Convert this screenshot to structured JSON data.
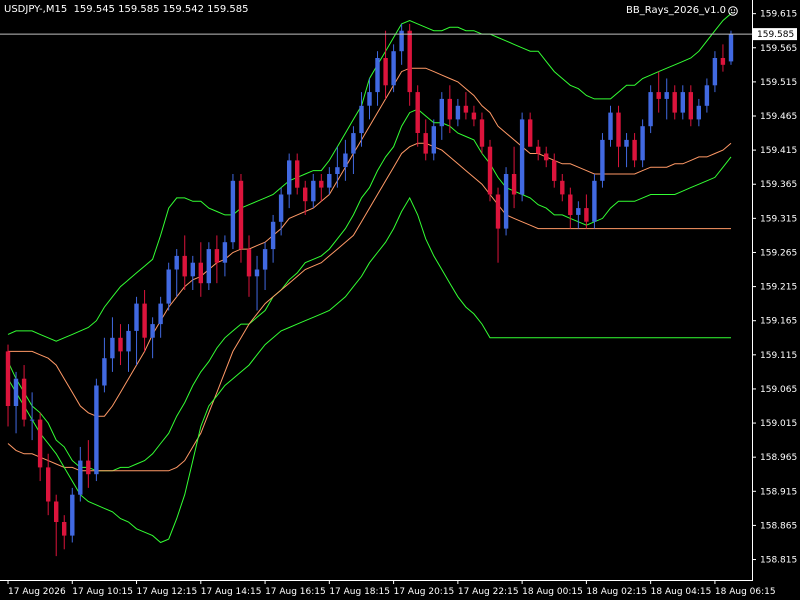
{
  "window": {
    "symbol": "USDJPY-,M15",
    "ohlc": "159.545 159.585 159.542 159.585",
    "indicator_name": "BB_Rays_2026_v1.0",
    "indicator_icon": "smiley-icon"
  },
  "colors": {
    "background": "#000000",
    "axis": "#ffffff",
    "bull_candle": "#4169e1",
    "bear_candle": "#dc143c",
    "outer_band": "#33ff33",
    "inner_band": "#ff9966",
    "price_line": "#c0c0c0"
  },
  "chart_data": {
    "type": "candlestick",
    "title": "",
    "xlabel": "",
    "ylabel": "",
    "ylim": [
      158.785,
      159.635
    ],
    "y_ticks": [
      "159.615",
      "159.565",
      "159.515",
      "159.465",
      "159.415",
      "159.365",
      "159.315",
      "159.265",
      "159.215",
      "159.165",
      "159.115",
      "159.065",
      "159.015",
      "158.965",
      "158.915",
      "158.865",
      "158.815"
    ],
    "x_ticks": [
      "17 Aug 2026",
      "17 Aug 10:15",
      "17 Aug 12:15",
      "17 Aug 14:15",
      "17 Aug 16:15",
      "17 Aug 18:15",
      "17 Aug 20:15",
      "17 Aug 22:15",
      "18 Aug 00:15",
      "18 Aug 02:15",
      "18 Aug 04:15",
      "18 Aug 06:15"
    ],
    "x_tick_bars": [
      0,
      8,
      16,
      24,
      32,
      40,
      48,
      56,
      64,
      72,
      80,
      88
    ],
    "current_price": "159.585",
    "candles": [
      [
        159.12,
        159.13,
        159.01,
        159.04
      ],
      [
        159.04,
        159.09,
        159.0,
        159.08
      ],
      [
        159.08,
        159.1,
        159.01,
        159.02
      ],
      [
        159.02,
        159.06,
        158.99,
        159.02
      ],
      [
        159.02,
        159.03,
        158.93,
        158.95
      ],
      [
        158.95,
        158.97,
        158.88,
        158.9
      ],
      [
        158.9,
        158.91,
        158.82,
        158.87
      ],
      [
        158.87,
        158.88,
        158.83,
        158.85
      ],
      [
        158.85,
        158.92,
        158.84,
        158.91
      ],
      [
        158.91,
        158.98,
        158.9,
        158.96
      ],
      [
        158.96,
        158.99,
        158.92,
        158.94
      ],
      [
        158.94,
        159.08,
        158.93,
        159.07
      ],
      [
        159.07,
        159.14,
        159.06,
        159.11
      ],
      [
        159.11,
        159.17,
        159.09,
        159.14
      ],
      [
        159.14,
        159.16,
        159.1,
        159.12
      ],
      [
        159.12,
        159.16,
        159.09,
        159.15
      ],
      [
        159.15,
        159.2,
        159.1,
        159.19
      ],
      [
        159.19,
        159.21,
        159.12,
        159.14
      ],
      [
        159.14,
        159.17,
        159.11,
        159.16
      ],
      [
        159.16,
        159.2,
        159.14,
        159.19
      ],
      [
        159.19,
        159.25,
        159.18,
        159.24
      ],
      [
        159.24,
        159.27,
        159.2,
        159.26
      ],
      [
        159.26,
        159.29,
        159.21,
        159.23
      ],
      [
        159.23,
        159.26,
        159.21,
        159.25
      ],
      [
        159.25,
        159.28,
        159.2,
        159.22
      ],
      [
        159.22,
        159.28,
        159.21,
        159.27
      ],
      [
        159.27,
        159.29,
        159.22,
        159.25
      ],
      [
        159.25,
        159.29,
        159.23,
        159.28
      ],
      [
        159.28,
        159.38,
        159.27,
        159.37
      ],
      [
        159.37,
        159.38,
        159.25,
        159.27
      ],
      [
        159.27,
        159.29,
        159.2,
        159.23
      ],
      [
        159.23,
        159.26,
        159.18,
        159.24
      ],
      [
        159.24,
        159.28,
        159.21,
        159.27
      ],
      [
        159.27,
        159.32,
        159.25,
        159.31
      ],
      [
        159.31,
        159.36,
        159.29,
        159.35
      ],
      [
        159.35,
        159.41,
        159.33,
        159.4
      ],
      [
        159.4,
        159.41,
        159.35,
        159.36
      ],
      [
        159.36,
        159.37,
        159.32,
        159.34
      ],
      [
        159.34,
        159.38,
        159.33,
        159.37
      ],
      [
        159.37,
        159.38,
        159.34,
        159.36
      ],
      [
        159.36,
        159.39,
        159.35,
        159.38
      ],
      [
        159.38,
        159.42,
        159.36,
        159.39
      ],
      [
        159.39,
        159.43,
        159.37,
        159.41
      ],
      [
        159.41,
        159.45,
        159.38,
        159.44
      ],
      [
        159.44,
        159.5,
        159.42,
        159.48
      ],
      [
        159.48,
        159.52,
        159.46,
        159.5
      ],
      [
        159.5,
        159.56,
        159.48,
        159.55
      ],
      [
        159.55,
        159.59,
        159.49,
        159.51
      ],
      [
        159.51,
        159.57,
        159.5,
        159.56
      ],
      [
        159.56,
        159.6,
        159.54,
        159.59
      ],
      [
        159.59,
        159.6,
        159.48,
        159.5
      ],
      [
        159.5,
        159.51,
        159.42,
        159.44
      ],
      [
        159.44,
        159.46,
        159.4,
        159.41
      ],
      [
        159.41,
        159.46,
        159.4,
        159.45
      ],
      [
        159.45,
        159.5,
        159.43,
        159.49
      ],
      [
        159.49,
        159.51,
        159.44,
        159.46
      ],
      [
        159.46,
        159.49,
        159.45,
        159.48
      ],
      [
        159.48,
        159.5,
        159.46,
        159.47
      ],
      [
        159.47,
        159.48,
        159.45,
        159.46
      ],
      [
        159.46,
        159.47,
        159.41,
        159.42
      ],
      [
        159.42,
        159.43,
        159.34,
        159.35
      ],
      [
        159.35,
        159.36,
        159.25,
        159.3
      ],
      [
        159.3,
        159.39,
        159.29,
        159.38
      ],
      [
        159.38,
        159.42,
        159.33,
        159.35
      ],
      [
        159.35,
        159.47,
        159.34,
        159.46
      ],
      [
        159.46,
        159.47,
        159.42,
        159.42
      ],
      [
        159.42,
        159.43,
        159.4,
        159.41
      ],
      [
        159.41,
        159.42,
        159.39,
        159.4
      ],
      [
        159.4,
        159.41,
        159.36,
        159.37
      ],
      [
        159.37,
        159.38,
        159.34,
        159.35
      ],
      [
        159.35,
        159.36,
        159.3,
        159.32
      ],
      [
        159.32,
        159.34,
        159.3,
        159.33
      ],
      [
        159.33,
        159.35,
        159.3,
        159.31
      ],
      [
        159.31,
        159.38,
        159.3,
        159.37
      ],
      [
        159.37,
        159.44,
        159.36,
        159.43
      ],
      [
        159.43,
        159.48,
        159.42,
        159.47
      ],
      [
        159.47,
        159.48,
        159.39,
        159.42
      ],
      [
        159.42,
        159.44,
        159.39,
        159.43
      ],
      [
        159.43,
        159.44,
        159.39,
        159.4
      ],
      [
        159.4,
        159.46,
        159.39,
        159.45
      ],
      [
        159.45,
        159.51,
        159.44,
        159.5
      ],
      [
        159.5,
        159.53,
        159.47,
        159.49
      ],
      [
        159.49,
        159.52,
        159.46,
        159.5
      ],
      [
        159.5,
        159.51,
        159.46,
        159.47
      ],
      [
        159.47,
        159.51,
        159.46,
        159.5
      ],
      [
        159.5,
        159.51,
        159.45,
        159.46
      ],
      [
        159.46,
        159.49,
        159.45,
        159.48
      ],
      [
        159.48,
        159.52,
        159.47,
        159.51
      ],
      [
        159.51,
        159.56,
        159.5,
        159.55
      ],
      [
        159.55,
        159.57,
        159.53,
        159.54
      ],
      [
        159.545,
        159.59,
        159.54,
        159.585
      ]
    ],
    "bands": [
      {
        "name": "",
        "color": "#33ff33",
        "values": [
          159.145,
          159.15,
          159.15,
          159.15,
          159.145,
          159.14,
          159.135,
          159.14,
          159.145,
          159.15,
          159.155,
          159.165,
          159.185,
          159.2,
          159.215,
          159.225,
          159.235,
          159.245,
          159.255,
          159.29,
          159.33,
          159.345,
          159.345,
          159.34,
          159.34,
          159.33,
          159.325,
          159.32,
          159.32,
          159.33,
          159.335,
          159.34,
          159.345,
          159.35,
          159.36,
          159.37,
          159.375,
          159.38,
          159.385,
          159.385,
          159.4,
          159.42,
          159.44,
          159.46,
          159.48,
          159.52,
          159.54,
          159.56,
          159.58,
          159.6,
          159.605,
          159.6,
          159.595,
          159.59,
          159.59,
          159.595,
          159.595,
          159.59,
          159.59,
          159.585,
          159.585,
          159.58,
          159.575,
          159.57,
          159.565,
          159.56,
          159.56,
          159.545,
          159.53,
          159.52,
          159.51,
          159.505,
          159.495,
          159.49,
          159.49,
          159.49,
          159.5,
          159.51,
          159.51,
          159.52,
          159.525,
          159.53,
          159.535,
          159.54,
          159.545,
          159.55,
          159.56,
          159.575,
          159.59,
          159.605,
          159.615
        ]
      },
      {
        "name": "",
        "color": "#ff9966",
        "values": [
          159.12,
          159.12,
          159.12,
          159.12,
          159.115,
          159.11,
          159.1,
          159.08,
          159.06,
          159.04,
          159.03,
          159.025,
          159.025,
          159.04,
          159.06,
          159.08,
          159.1,
          159.12,
          159.145,
          159.165,
          159.185,
          159.2,
          159.215,
          159.225,
          159.23,
          159.24,
          159.25,
          159.255,
          159.265,
          159.27,
          159.27,
          159.275,
          159.28,
          159.29,
          159.3,
          159.315,
          159.32,
          159.325,
          159.33,
          159.34,
          159.35,
          159.37,
          159.39,
          159.41,
          159.43,
          159.45,
          159.47,
          159.49,
          159.51,
          159.53,
          159.535,
          159.535,
          159.535,
          159.53,
          159.525,
          159.52,
          159.515,
          159.505,
          159.495,
          159.48,
          159.47,
          159.45,
          159.44,
          159.43,
          159.42,
          159.41,
          159.41,
          159.405,
          159.4,
          159.395,
          159.395,
          159.39,
          159.385,
          159.38,
          159.38,
          159.38,
          159.38,
          159.38,
          159.38,
          159.385,
          159.39,
          159.39,
          159.39,
          159.395,
          159.395,
          159.4,
          159.405,
          159.405,
          159.41,
          159.415,
          159.425
        ]
      },
      {
        "name": "",
        "color": "#33ff33",
        "values": [
          159.105,
          159.08,
          159.06,
          159.04,
          159.03,
          159.015,
          158.99,
          158.98,
          158.96,
          158.95,
          158.95,
          158.945,
          158.945,
          158.945,
          158.95,
          158.95,
          158.955,
          158.96,
          158.97,
          158.985,
          159.0,
          159.025,
          159.045,
          159.07,
          159.09,
          159.105,
          159.125,
          159.14,
          159.15,
          159.16,
          159.16,
          159.17,
          159.18,
          159.2,
          159.21,
          159.225,
          159.235,
          159.25,
          159.255,
          159.26,
          159.27,
          159.285,
          159.3,
          159.32,
          159.345,
          159.36,
          159.385,
          159.405,
          159.42,
          159.45,
          159.47,
          159.475,
          159.465,
          159.455,
          159.455,
          159.45,
          159.44,
          159.435,
          159.43,
          159.41,
          159.395,
          159.375,
          159.36,
          159.355,
          159.35,
          159.345,
          159.335,
          159.33,
          159.32,
          159.32,
          159.315,
          159.31,
          159.305,
          159.31,
          159.315,
          159.33,
          159.34,
          159.34,
          159.34,
          159.345,
          159.35,
          159.35,
          159.35,
          159.35,
          159.355,
          159.36,
          159.365,
          159.37,
          159.375,
          159.39,
          159.405
        ]
      },
      {
        "name": "",
        "color": "#ff9966",
        "values": [
          158.985,
          158.975,
          158.97,
          158.97,
          158.965,
          158.96,
          158.955,
          158.95,
          158.95,
          158.945,
          158.945,
          158.945,
          158.945,
          158.945,
          158.945,
          158.945,
          158.945,
          158.945,
          158.945,
          158.945,
          158.945,
          158.95,
          158.96,
          158.98,
          159.0,
          159.03,
          159.06,
          159.09,
          159.12,
          159.14,
          159.16,
          159.175,
          159.19,
          159.2,
          159.21,
          159.22,
          159.23,
          159.24,
          159.245,
          159.25,
          159.26,
          159.27,
          159.28,
          159.29,
          159.31,
          159.33,
          159.35,
          159.37,
          159.39,
          159.41,
          159.42,
          159.425,
          159.425,
          159.42,
          159.415,
          159.405,
          159.395,
          159.385,
          159.375,
          159.365,
          159.35,
          159.335,
          159.32,
          159.315,
          159.31,
          159.305,
          159.3,
          159.3,
          159.3,
          159.3,
          159.3,
          159.3,
          159.3,
          159.3,
          159.3,
          159.3,
          159.3,
          159.3,
          159.3,
          159.3,
          159.3,
          159.3,
          159.3,
          159.3,
          159.3,
          159.3,
          159.3,
          159.3,
          159.3,
          159.3,
          159.3
        ]
      },
      {
        "name": "",
        "color": "#33ff33",
        "values": [
          159.08,
          159.06,
          159.04,
          159.02,
          159.0,
          158.985,
          158.97,
          158.95,
          158.93,
          158.91,
          158.9,
          158.895,
          158.89,
          158.885,
          158.875,
          158.87,
          158.86,
          158.855,
          158.85,
          158.84,
          158.845,
          158.875,
          158.91,
          158.96,
          159.01,
          159.04,
          159.055,
          159.07,
          159.08,
          159.09,
          159.1,
          159.115,
          159.13,
          159.14,
          159.15,
          159.155,
          159.16,
          159.165,
          159.17,
          159.175,
          159.18,
          159.19,
          159.2,
          159.215,
          159.23,
          159.25,
          159.265,
          159.28,
          159.3,
          159.325,
          159.345,
          159.32,
          159.285,
          159.26,
          159.24,
          159.22,
          159.2,
          159.185,
          159.175,
          159.16,
          159.14,
          159.14,
          159.14,
          159.14,
          159.14,
          159.14,
          159.14,
          159.14,
          159.14,
          159.14,
          159.14,
          159.14,
          159.14,
          159.14,
          159.14,
          159.14,
          159.14,
          159.14,
          159.14,
          159.14,
          159.14,
          159.14,
          159.14,
          159.14,
          159.14,
          159.14,
          159.14,
          159.14,
          159.14,
          159.14,
          159.14
        ]
      }
    ],
    "bands_note": ""
  }
}
